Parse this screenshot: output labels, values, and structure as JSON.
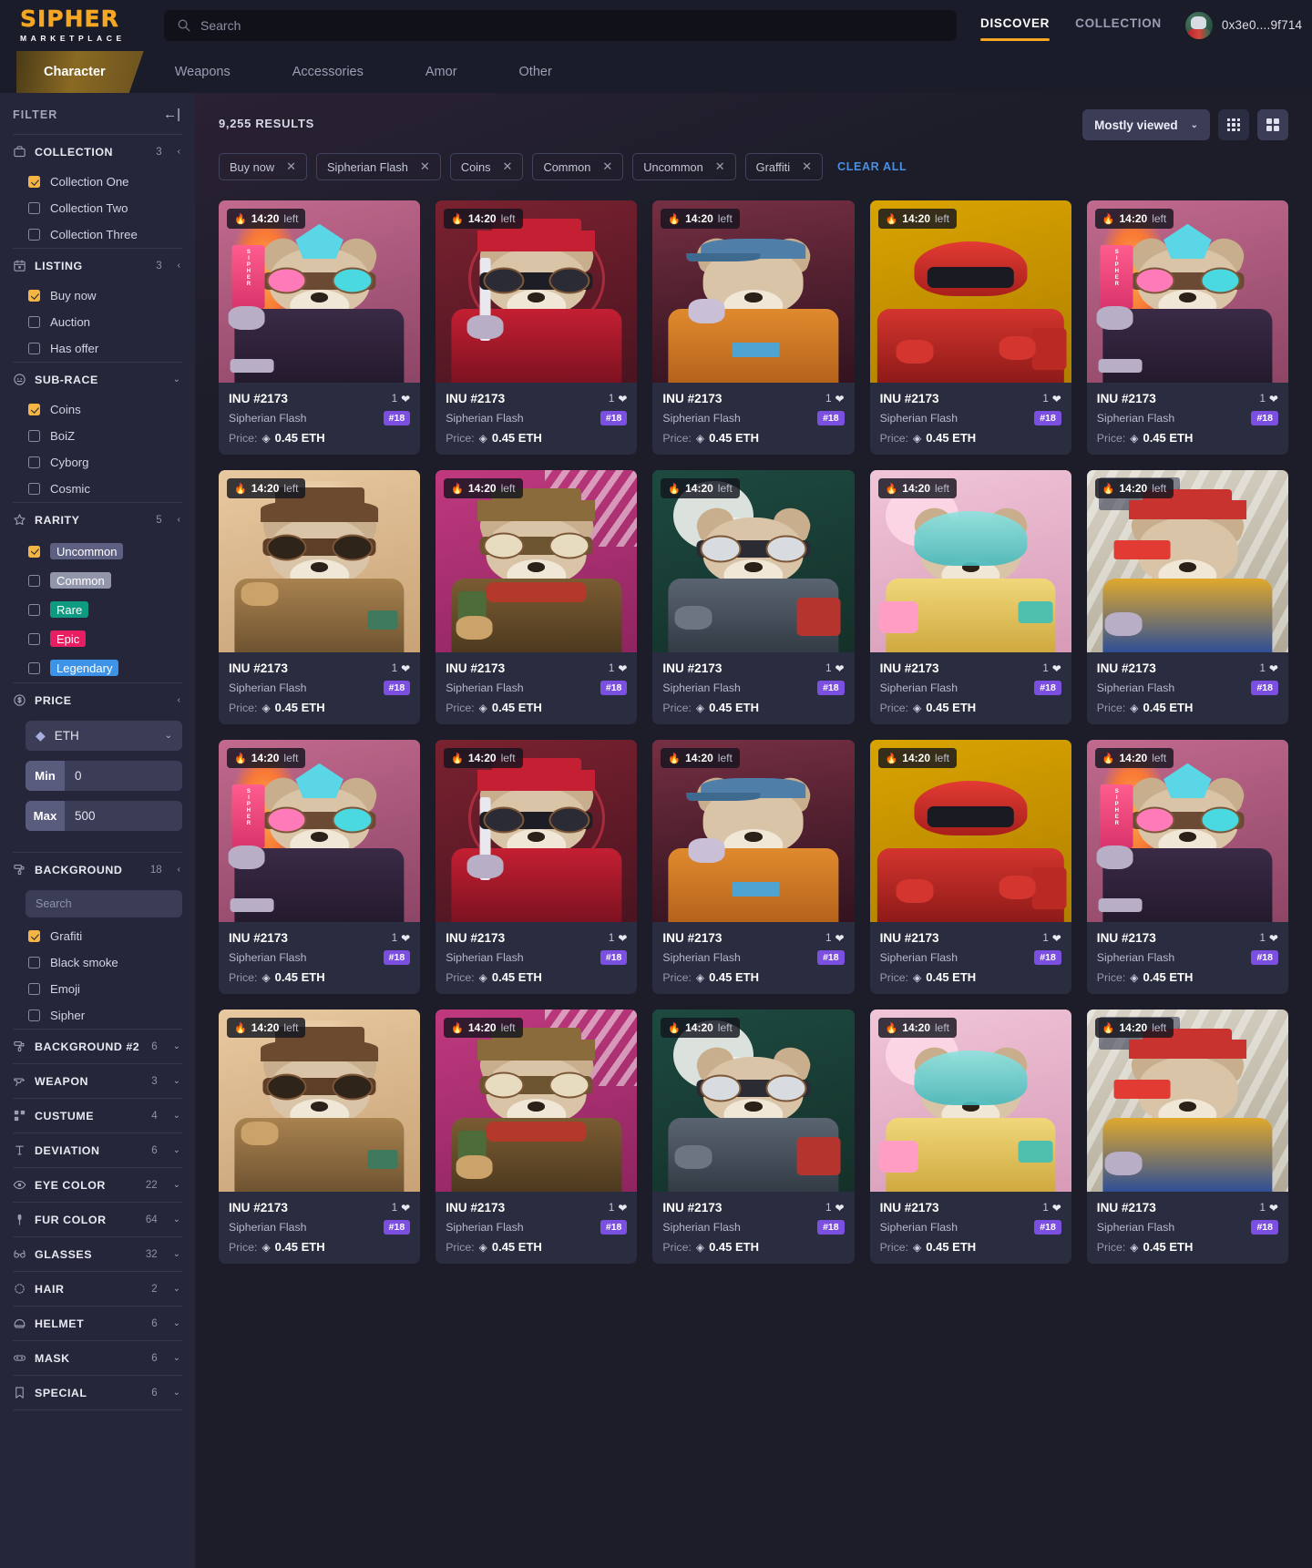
{
  "header": {
    "logo_main": "SIPHER",
    "logo_sub": "MARKETPLACE",
    "search_placeholder": "Search",
    "search_value": "",
    "nav": [
      {
        "label": "DISCOVER",
        "active": true
      },
      {
        "label": "COLLECTION",
        "active": false
      }
    ],
    "wallet_address": "0x3e0....9f714"
  },
  "categories": [
    {
      "label": "Character",
      "active": true
    },
    {
      "label": "Weapons",
      "active": false
    },
    {
      "label": "Accessories",
      "active": false
    },
    {
      "label": "Amor",
      "active": false
    },
    {
      "label": "Other",
      "active": false
    }
  ],
  "sidebar": {
    "title": "FILTER",
    "collapse_icon": "←|",
    "sections": [
      {
        "name": "COLLECTION",
        "count": "3",
        "icon": "briefcase-icon",
        "arrow": "‹",
        "expanded": true,
        "options": [
          {
            "label": "Collection One",
            "checked": true
          },
          {
            "label": "Collection Two",
            "checked": false
          },
          {
            "label": "Collection Three",
            "checked": false
          }
        ]
      },
      {
        "name": "LISTING",
        "count": "3",
        "icon": "calendar-icon",
        "arrow": "‹",
        "expanded": true,
        "options": [
          {
            "label": "Buy now",
            "checked": true
          },
          {
            "label": "Auction",
            "checked": false
          },
          {
            "label": "Has offer",
            "checked": false
          }
        ]
      },
      {
        "name": "SUB-RACE",
        "count": "",
        "icon": "face-icon",
        "arrow": "⌄",
        "expanded": true,
        "options": [
          {
            "label": "Coins",
            "checked": true
          },
          {
            "label": "BoiZ",
            "checked": false
          },
          {
            "label": "Cyborg",
            "checked": false
          },
          {
            "label": "Cosmic",
            "checked": false
          }
        ]
      },
      {
        "name": "RARITY",
        "count": "5",
        "icon": "star-icon",
        "arrow": "‹",
        "expanded": true,
        "options": [
          {
            "label": "Uncommon",
            "checked": true,
            "tag_color": "#5d6080"
          },
          {
            "label": "Common",
            "checked": false,
            "tag_color": "#9296ab"
          },
          {
            "label": "Rare",
            "checked": false,
            "tag_color": "#0f9b82"
          },
          {
            "label": "Epic",
            "checked": false,
            "tag_color": "#e81e63"
          },
          {
            "label": "Legendary",
            "checked": false,
            "tag_color": "#3d93e8"
          }
        ]
      }
    ],
    "price": {
      "name": "PRICE",
      "icon": "dollar-icon",
      "arrow": "‹",
      "currency": "ETH",
      "currency_icon": "eth-icon",
      "min_label": "Min",
      "min_value": "0",
      "max_label": "Max",
      "max_value": "500"
    },
    "background": {
      "name": "BACKGROUND",
      "count": "18",
      "icon": "paint-roller-icon",
      "arrow": "‹",
      "search_placeholder": "Search",
      "options": [
        {
          "label": "Grafiti",
          "checked": true
        },
        {
          "label": "Black smoke",
          "checked": false
        },
        {
          "label": "Emoji",
          "checked": false
        },
        {
          "label": "Sipher",
          "checked": false
        }
      ]
    },
    "collapsed_sections": [
      {
        "name": "BACKGROUND #2",
        "count": "6",
        "icon": "paint-roller-icon",
        "arrow": "⌄"
      },
      {
        "name": "WEAPON",
        "count": "3",
        "icon": "gun-icon",
        "arrow": "⌄"
      },
      {
        "name": "CUSTUME",
        "count": "4",
        "icon": "grid-icon",
        "arrow": "⌄"
      },
      {
        "name": "DEVIATION",
        "count": "6",
        "icon": "text-icon",
        "arrow": "⌄"
      },
      {
        "name": "EYE COLOR",
        "count": "22",
        "icon": "eye-icon",
        "arrow": "⌄"
      },
      {
        "name": "FUR COLOR",
        "count": "64",
        "icon": "brush-icon",
        "arrow": "⌄"
      },
      {
        "name": "GLASSES",
        "count": "32",
        "icon": "glasses-icon",
        "arrow": "⌄"
      },
      {
        "name": "HAIR",
        "count": "2",
        "icon": "hair-icon",
        "arrow": "⌄"
      },
      {
        "name": "HELMET",
        "count": "6",
        "icon": "helmet-icon",
        "arrow": "⌄"
      },
      {
        "name": "MASK",
        "count": "6",
        "icon": "mask-icon",
        "arrow": "⌄"
      },
      {
        "name": "SPECIAL",
        "count": "6",
        "icon": "bookmark-icon",
        "arrow": "⌄"
      }
    ]
  },
  "main": {
    "results_text": "9,255 RESULTS",
    "chips": [
      {
        "label": "Buy now"
      },
      {
        "label": "Sipherian Flash"
      },
      {
        "label": "Coins"
      },
      {
        "label": "Common"
      },
      {
        "label": "Uncommon"
      },
      {
        "label": "Graffiti"
      }
    ],
    "chip_close_icon": "✕",
    "clear_all": "CLEAR ALL",
    "sort": {
      "label": "Mostly viewed",
      "chevron": "⌄"
    },
    "view_modes": [
      {
        "name": "compact-grid",
        "active": false
      },
      {
        "name": "large-grid",
        "active": true
      }
    ],
    "card_defaults": {
      "timer": "14:20",
      "timer_suffix": "left",
      "name": "INU #2173",
      "collection": "Sipherian Flash",
      "badge": "#18",
      "likes": "1",
      "price_label": "Price:",
      "eth_icon": "◈",
      "price": "0.45 ETH"
    },
    "cards": [
      {
        "variant": "punk",
        "bg_a": "#c16a8e",
        "bg_b": "#8d4566"
      },
      {
        "variant": "redhat",
        "bg_a": "#7a2230",
        "bg_b": "#4a1420"
      },
      {
        "variant": "cap",
        "bg_a": "#8f3a52",
        "bg_b": "#5e2338"
      },
      {
        "variant": "redsuit",
        "bg_a": "#d9a400",
        "bg_b": "#b07f00"
      },
      {
        "variant": "punk",
        "bg_a": "#c16a8e",
        "bg_b": "#8d4566"
      },
      {
        "variant": "pilot",
        "bg_a": "#e8c9a0",
        "bg_b": "#c9a277"
      },
      {
        "variant": "ranger",
        "bg_a": "#c0397f",
        "bg_b": "#8e2560"
      },
      {
        "variant": "forest",
        "bg_a": "#1d4a40",
        "bg_b": "#143029"
      },
      {
        "variant": "pastel",
        "bg_a": "#f1c6d8",
        "bg_b": "#d79ab8"
      },
      {
        "variant": "street",
        "bg_a": "#d8d3c6",
        "bg_b": "#b0a997"
      },
      {
        "variant": "punk",
        "bg_a": "#c16a8e",
        "bg_b": "#8d4566"
      },
      {
        "variant": "redhat",
        "bg_a": "#7a2230",
        "bg_b": "#4a1420"
      },
      {
        "variant": "cap",
        "bg_a": "#8f3a52",
        "bg_b": "#5e2338"
      },
      {
        "variant": "redsuit",
        "bg_a": "#d9a400",
        "bg_b": "#b07f00"
      },
      {
        "variant": "punk",
        "bg_a": "#c16a8e",
        "bg_b": "#8d4566"
      },
      {
        "variant": "pilot",
        "bg_a": "#e8c9a0",
        "bg_b": "#c9a277"
      },
      {
        "variant": "ranger",
        "bg_a": "#c0397f",
        "bg_b": "#8e2560"
      },
      {
        "variant": "forest",
        "bg_a": "#1d4a40",
        "bg_b": "#143029"
      },
      {
        "variant": "pastel",
        "bg_a": "#f1c6d8",
        "bg_b": "#d79ab8"
      },
      {
        "variant": "street",
        "bg_a": "#d8d3c6",
        "bg_b": "#b0a997"
      }
    ]
  }
}
